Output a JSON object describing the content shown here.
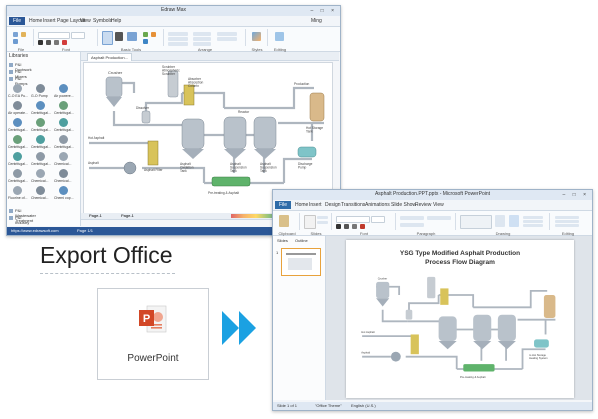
{
  "edraw": {
    "title": "Edraw Max",
    "window_controls": "– □ ×",
    "menu_file": "File",
    "menu": [
      "Home",
      "Insert",
      "Page Layout",
      "View",
      "Symbols",
      "Help"
    ],
    "user": "Ming",
    "ribbon_groups": [
      "File",
      "Font",
      "Basic Tools",
      "Arrange",
      "Styles",
      "Editing"
    ],
    "libraries_title": "Libraries",
    "library_categories": [
      "P&I Ductwork",
      "P&I Mixers",
      "P&I Pumps"
    ],
    "library_bottom": [
      "P&I Wastewater Treatment",
      "P&I Industry"
    ],
    "shape_labels": [
      [
        "C-O EA Pu...",
        "G-O Pump",
        "Air powere..."
      ],
      [
        "Air operate...",
        "Centrifugal...",
        "Centrifugal..."
      ],
      [
        "Centrifugal...",
        "Centrifugal...",
        "Centrifugal..."
      ],
      [
        "Centrifugal...",
        "Centrifugal...",
        "Centrifugal..."
      ],
      [
        "Centrifugal...",
        "Centrifugal...",
        "Chemical..."
      ],
      [
        "Centrifugal...",
        "Chemical...",
        "Chemical..."
      ],
      [
        "Fluorine of...",
        "Chemical...",
        "Chemi cop..."
      ]
    ],
    "doc_tab": "Asphalt Production...",
    "page_tabs": [
      "Page-1",
      "Page-1"
    ],
    "status_url": "https://www.edrawsoft.com",
    "status_page": "Page 1/1",
    "panel_tabs": [
      "Libraries",
      "File Recovery"
    ]
  },
  "diagram_labels": {
    "crusher": "Crusher",
    "scrubber": "Scrubber\nAtmospheric\nScrubber",
    "dissolver": "Dissolver",
    "absorber": "Absorber\nAbsorption\nColumn",
    "prod": "Production",
    "sulfur": "Asphalt\nDisposal",
    "to_storage": "Hot Storage\nTank",
    "hot_asphalt": "Hot Asphalt",
    "asphalt": "Asphalt",
    "asphalt_filter": "Asphalt Filter",
    "heater": "Asphalt\nFilter",
    "blowing": "Asphalt\nOxidation\nTank",
    "reactor": "Reactor",
    "suspension": "Asphalt\nSuspension\nTank",
    "packing": "Pre-treating & Asphalt",
    "discharge": "Discharge\nPump",
    "to_hot": "to Hot Storage\nHeating System"
  },
  "export": {
    "title": "Export Office",
    "card_label": "PowerPoint",
    "ppt_logo_letter": "P"
  },
  "powerpoint": {
    "title": "Asphalt Production.PPT.pptx - Microsoft PowerPoint",
    "menu_file": "File",
    "menu": [
      "Home",
      "Insert",
      "Design",
      "Transitions",
      "Animations",
      "Slide Show",
      "Review",
      "View"
    ],
    "ribbon_groups": [
      "Clipboard",
      "Slides",
      "Font",
      "Paragraph",
      "Drawing",
      "Editing"
    ],
    "side_tabs": [
      "Slides",
      "Outline"
    ],
    "slide_number": "1",
    "slide_title_line1": "YSG Type Modified Asphalt Production",
    "slide_title_line2": "Process Flow Diagram",
    "status_left": "Slide 1 of 1",
    "status_mid": "\"Office Theme\"",
    "status_lang": "English (U.S.)"
  },
  "colors": {
    "edraw_blue": "#2b5797",
    "ppt_orange": "#d24726",
    "chevron": "#1ba1e2",
    "pipe": "#aeb6bf",
    "tank": "#b9c2cb",
    "hot_tank": "#d9b98a",
    "green_equip": "#5fb36b"
  }
}
